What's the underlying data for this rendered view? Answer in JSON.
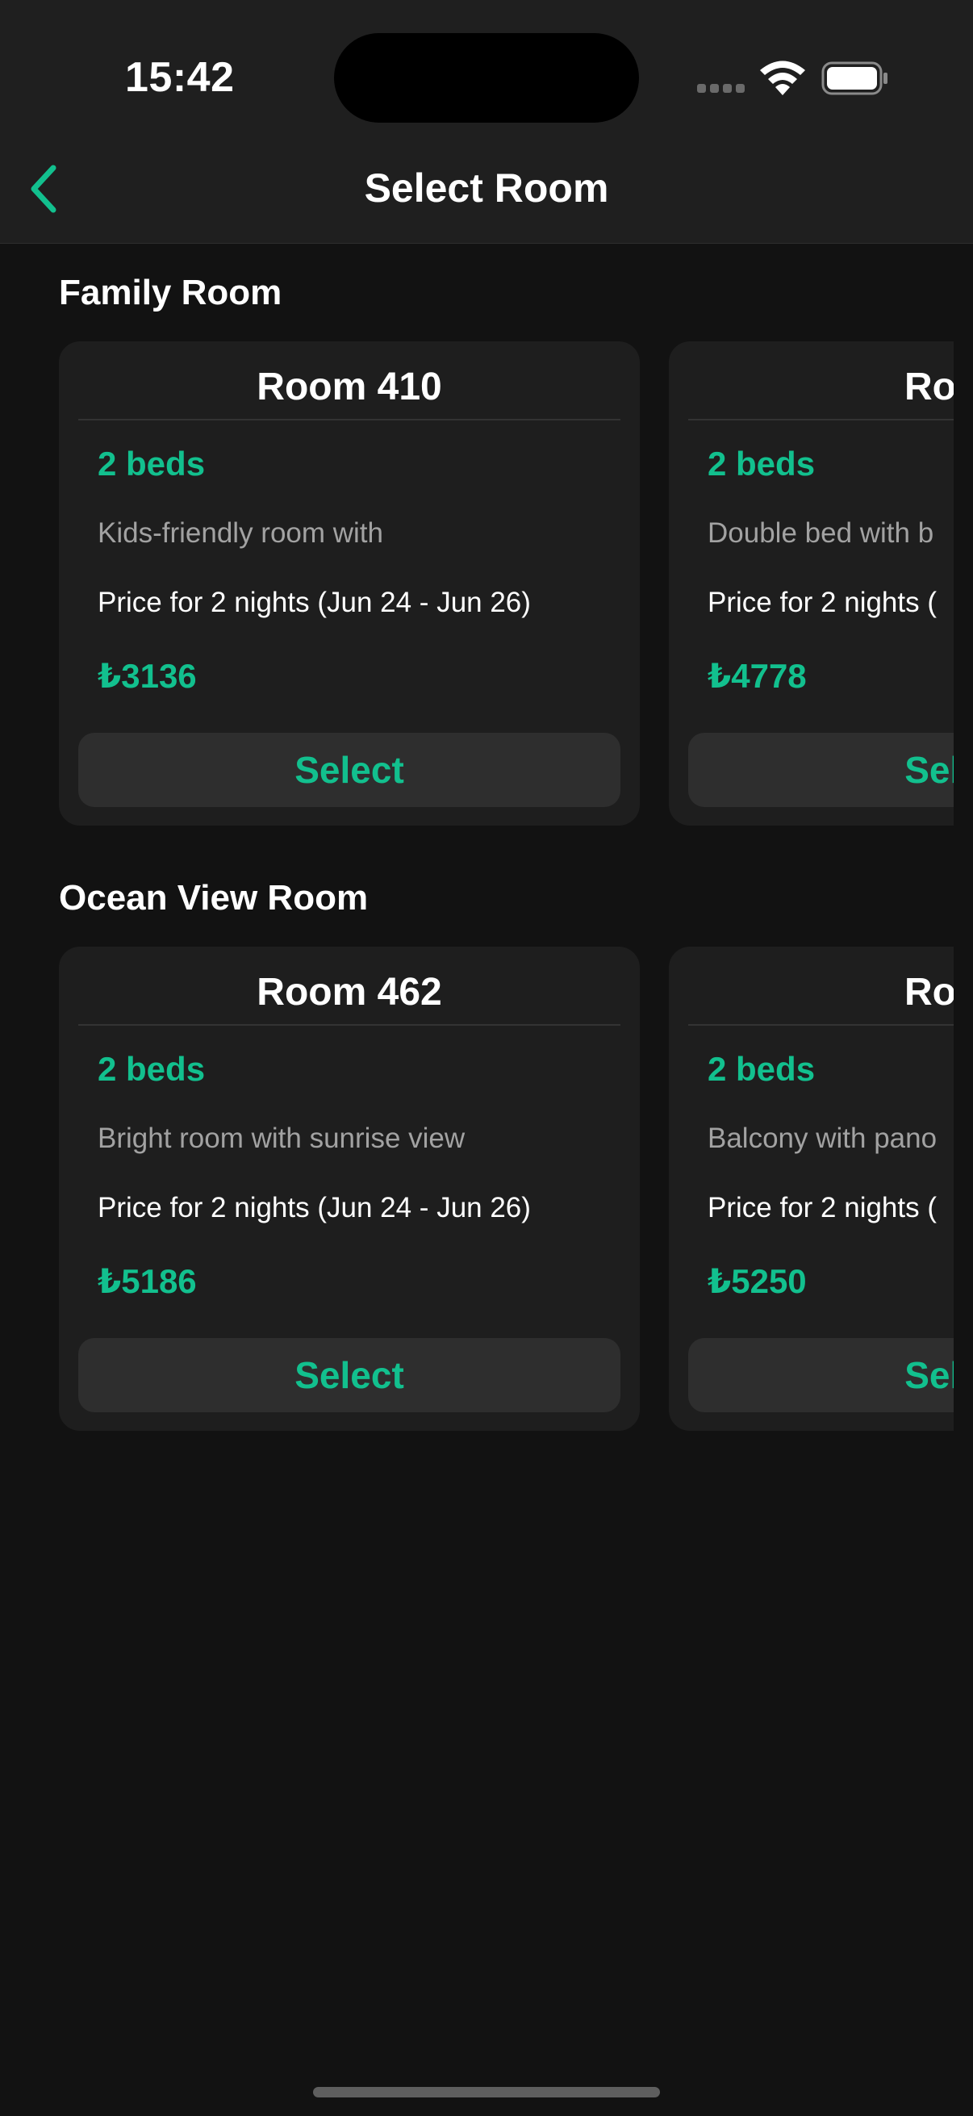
{
  "status_bar": {
    "time": "15:42"
  },
  "nav": {
    "title": "Select Room"
  },
  "theme": {
    "accent": "#12c08e",
    "background": "#121212",
    "card": "#1e1e1e",
    "button": "#2e2e2e"
  },
  "sections": [
    {
      "title": "Family Room",
      "rooms": [
        {
          "name": "Room 410",
          "beds": "2 beds",
          "description": "Kids-friendly room with",
          "price_label": "Price for 2 nights (Jun 24 - Jun 26)",
          "price": "₺3136",
          "button": "Select"
        },
        {
          "name": "Room",
          "beds": "2 beds",
          "description": "Double bed with b",
          "price_label": "Price for 2 nights (",
          "price": "₺4778",
          "button": "Select"
        }
      ]
    },
    {
      "title": "Ocean View Room",
      "rooms": [
        {
          "name": "Room 462",
          "beds": "2 beds",
          "description": "Bright room with sunrise view",
          "price_label": "Price for 2 nights (Jun 24 - Jun 26)",
          "price": "₺5186",
          "button": "Select"
        },
        {
          "name": "Room",
          "beds": "2 beds",
          "description": "Balcony with pano",
          "price_label": "Price for 2 nights (",
          "price": "₺5250",
          "button": "Select"
        }
      ]
    }
  ]
}
